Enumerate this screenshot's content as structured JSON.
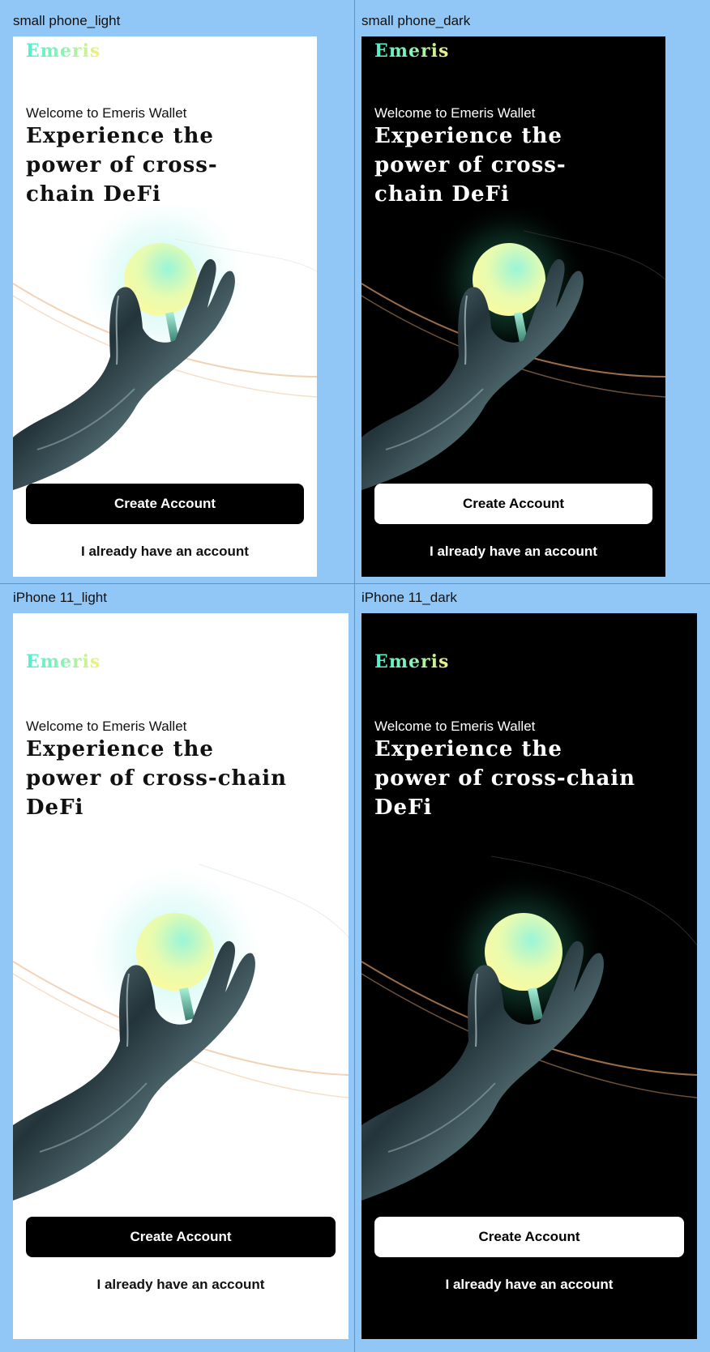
{
  "frames": {
    "small_light": {
      "label": "small phone_light"
    },
    "small_dark": {
      "label": "small phone_dark"
    },
    "iphone_light": {
      "label": "iPhone 11_light"
    },
    "iphone_dark": {
      "label": "iPhone 11_dark"
    }
  },
  "app": {
    "logo": "Emeris",
    "welcome": "Welcome to Emeris Wallet",
    "headline_small": [
      "Experience the",
      "power of cross-",
      "chain DeFi"
    ],
    "headline_large": [
      "Experience the",
      "power of cross-chain",
      "DeFi"
    ],
    "create_account": "Create Account",
    "login": "I already have an account"
  },
  "colors": {
    "canvas": "#90c7f6",
    "logo_gradient": [
      "#4ef0d0",
      "#f4f27c"
    ],
    "light_bg": "#ffffff",
    "dark_bg": "#000000"
  }
}
